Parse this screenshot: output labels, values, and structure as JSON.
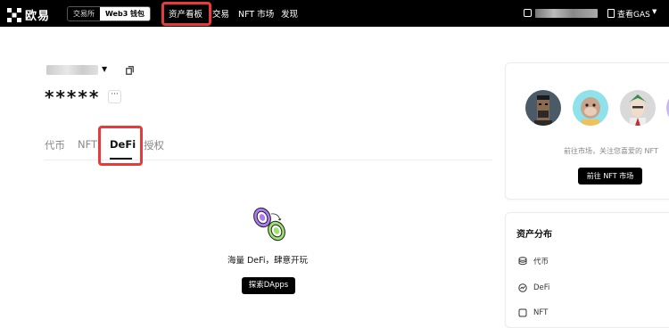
{
  "header": {
    "logo_text": "欧易",
    "mode_exchange": "交易所",
    "mode_web3": "Web3 钱包",
    "nav": {
      "assets": "资产看板",
      "trade": "交易",
      "nft_market": "NFT 市场",
      "discover": "发现"
    },
    "gas_label": "查看GAS"
  },
  "account": {
    "balance_masked": "*****",
    "more": "···"
  },
  "tabs": {
    "tokens": "代币",
    "nft": "NFT",
    "defi": "DeFi",
    "approvals": "授权"
  },
  "empty_state": {
    "message": "海量 DeFi，肆意开玩",
    "button": "探索DApps"
  },
  "nft_card": {
    "description": "前往市场，关注您喜爱的 NFT",
    "button": "前往 NFT 市场"
  },
  "distribution": {
    "title": "资产分布",
    "items": [
      "代币",
      "DeFi",
      "NFT"
    ]
  },
  "colors": {
    "highlight": "#e83a3a",
    "topbar": "#000000"
  }
}
